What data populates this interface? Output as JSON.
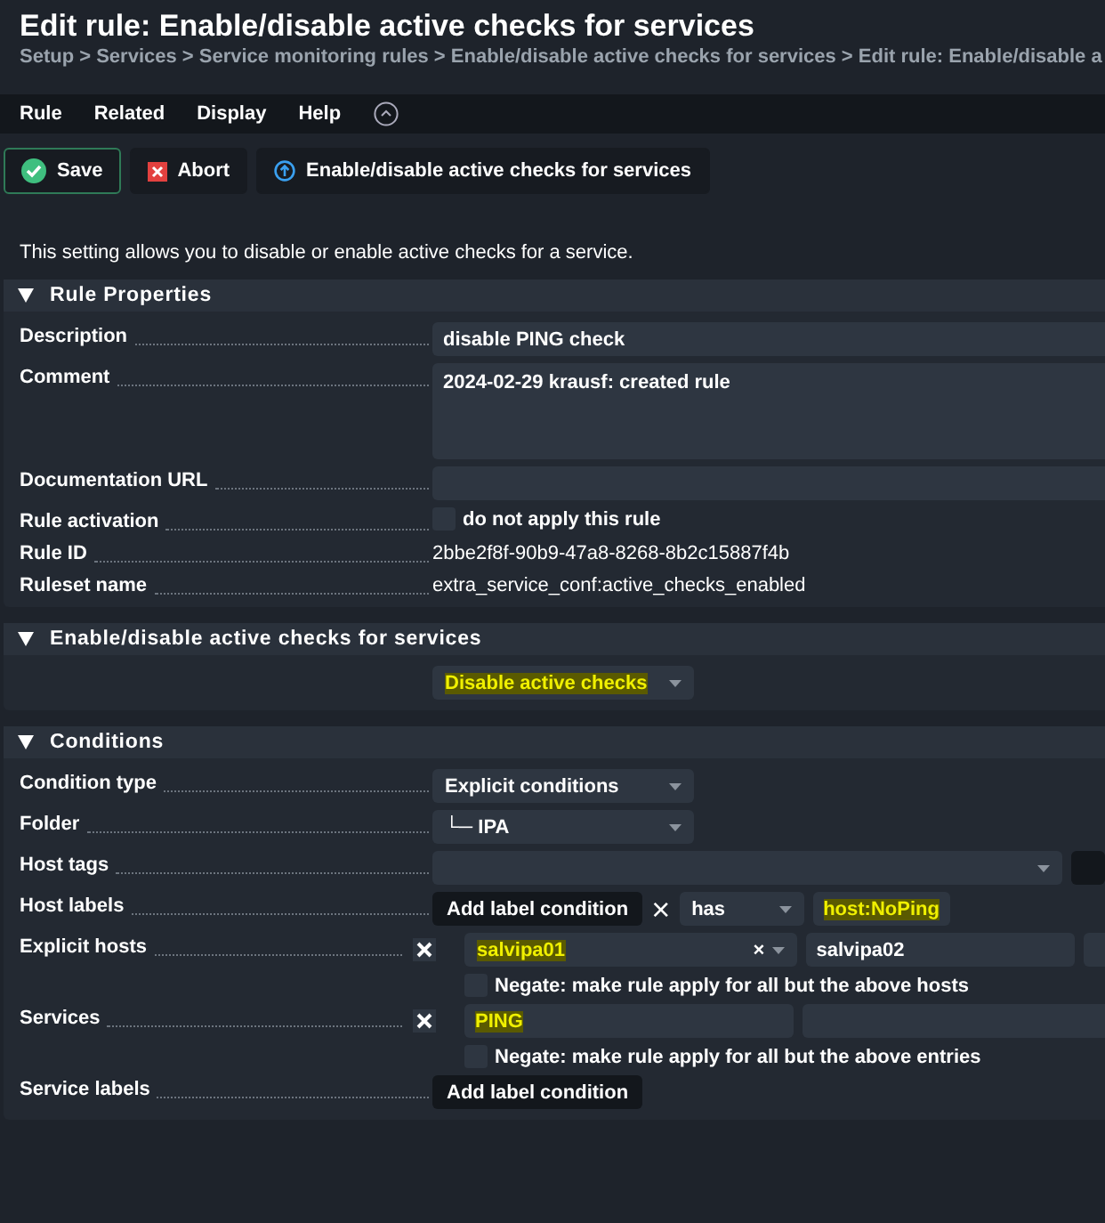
{
  "title": "Edit rule: Enable/disable active checks for services",
  "breadcrumb": "Setup > Services > Service monitoring rules > Enable/disable active checks for services > Edit rule: Enable/disable a",
  "menu": [
    "Rule",
    "Related",
    "Display",
    "Help"
  ],
  "actions": [
    {
      "kind": "save",
      "label": "Save"
    },
    {
      "kind": "abort",
      "label": "Abort"
    },
    {
      "kind": "info",
      "label": "Enable/disable active checks for services"
    }
  ],
  "intro": "This setting allows you to disable or enable active checks for a service.",
  "sections": [
    {
      "title": "Rule Properties",
      "expanded": true,
      "rows": [
        {
          "label": "Description",
          "kind": "text",
          "value": "disable PING check"
        },
        {
          "label": "Comment",
          "kind": "textarea",
          "value": "2024-02-29 krausf: created rule"
        },
        {
          "label": "Documentation URL",
          "kind": "text"
        },
        {
          "label": "Rule activation",
          "kind": "checkbox",
          "checked": false,
          "text": "do not apply this rule"
        },
        {
          "label": "Rule ID",
          "kind": "plain",
          "value": "2bbe2f8f-90b9-47a8-8268-8b2c15887f4b"
        },
        {
          "label": "Ruleset name",
          "kind": "plain",
          "value": "extra_service_conf:active_checks_enabled"
        }
      ]
    },
    {
      "title": "Enable/disable active checks for services",
      "expanded": true,
      "rows": [
        {
          "kind": "select",
          "value": "Disable active checks",
          "highlighted": true
        }
      ]
    },
    {
      "title": "Conditions",
      "expanded": true,
      "rows": [
        {
          "label": "Condition type",
          "kind": "select",
          "value": "Explicit conditions",
          "highlighted": false
        },
        {
          "label": "Folder",
          "kind": "select",
          "value": "└─ IPA",
          "highlighted": false
        },
        {
          "label": "Host tags",
          "kind": "tags"
        },
        {
          "label": "Host labels",
          "kind": "labels",
          "button": "Add label condition",
          "remove": "×",
          "operator": "has",
          "value": "host:NoPing",
          "highlighted": true
        },
        {
          "label": "Explicit hosts",
          "kind": "list",
          "entries": [
            {
              "kind": "select",
              "text": "salvipa01",
              "highlighted": true,
              "clear": "×"
            },
            {
              "kind": "text",
              "text": "salvipa02",
              "highlighted": false
            }
          ],
          "negate_checked": false,
          "negate": "Negate: make rule apply for all but the above hosts"
        },
        {
          "label": "Services",
          "kind": "list",
          "entries": [
            {
              "kind": "text",
              "text": "PING",
              "highlighted": true
            }
          ],
          "negate_checked": false,
          "negate": "Negate: make rule apply for all but the above entries"
        },
        {
          "label": "Service labels",
          "kind": "button",
          "button": "Add label condition"
        }
      ]
    }
  ]
}
